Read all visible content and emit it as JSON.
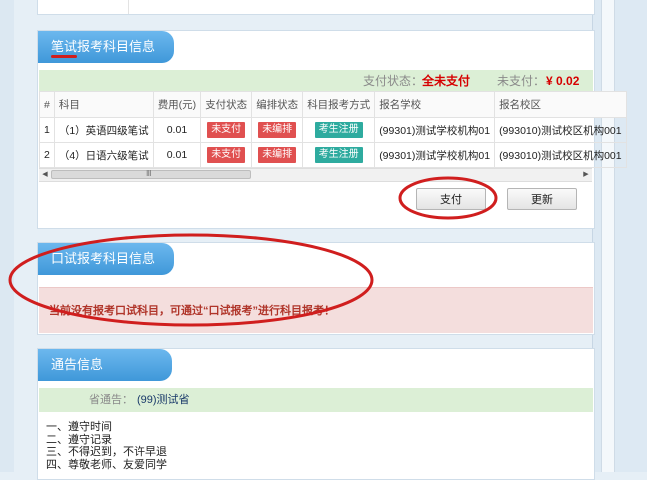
{
  "written_section": {
    "title": "笔试报考科目信息",
    "pay_status_label": "支付状态：",
    "pay_status_value": "全未支付",
    "unpaid_label": "未支付：",
    "unpaid_value": "¥ 0.02",
    "columns": [
      "#",
      "科目",
      "费用(元)",
      "支付状态",
      "编排状态",
      "科目报考方式",
      "报名学校",
      "报名校区"
    ],
    "rows": [
      {
        "num": "1",
        "subject": "（1）英语四级笔试",
        "fee": "0.01",
        "pay": "未支付",
        "arrange": "未编排",
        "method": "考生注册",
        "school": "(99301)测试学校机构01",
        "campus": "(993010)测试校区机构001"
      },
      {
        "num": "2",
        "subject": "（4）日语六级笔试",
        "fee": "0.01",
        "pay": "未支付",
        "arrange": "未编排",
        "method": "考生注册",
        "school": "(99301)测试学校机构01",
        "campus": "(993010)测试校区机构001"
      }
    ],
    "pay_button": "支付",
    "refresh_button": "更新"
  },
  "oral_section": {
    "title": "口试报考科目信息",
    "message": "当前没有报考口试科目，可通过“口试报考”进行科目报考！"
  },
  "notice_section": {
    "title": "通告信息",
    "province_label": "省通告：",
    "province_value": "(99)测试省",
    "lines": [
      "一、遵守时间",
      "二、遵守记录",
      "三、不得迟到，不许早退",
      "四、尊敬老师、友爱同学"
    ]
  },
  "scrollbar": {
    "left_arrow": "◀",
    "right_arrow": "▶",
    "grip": "Ⅲ"
  },
  "colors": {
    "accent_blue": "#3f98d9",
    "status_green": "#dcefd6",
    "alert_red": "#d60000",
    "badge_red": "#e05050",
    "badge_teal": "#2eab9f",
    "annotation_red": "#d01e1e"
  }
}
